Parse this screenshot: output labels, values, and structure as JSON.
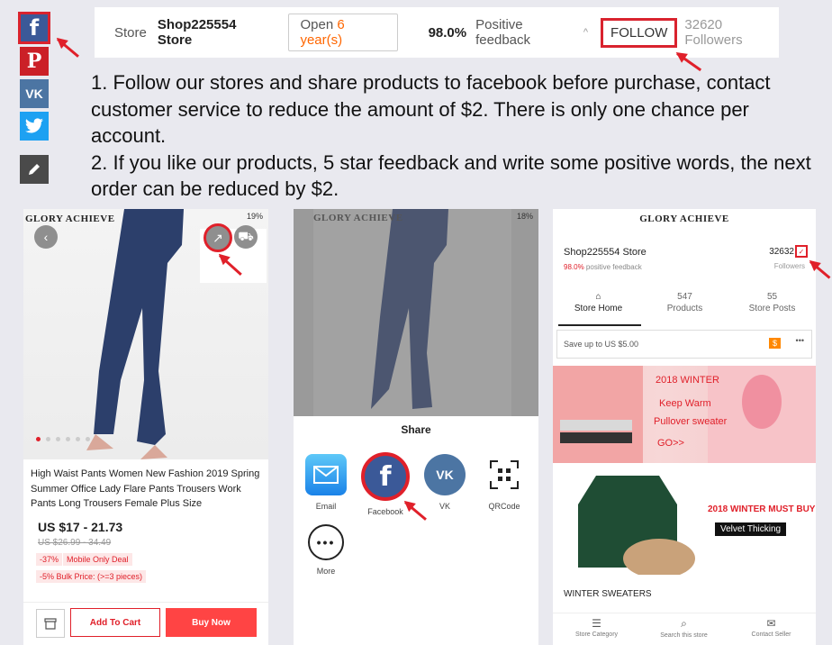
{
  "social": {
    "facebook_glyph": "f",
    "pinterest_glyph": "P",
    "vk_glyph": "VK"
  },
  "store_bar": {
    "store_label": "Store",
    "store_name": "Shop225554 Store",
    "open_prefix": "Open",
    "open_years": "6 year(s)",
    "feedback_percent": "98.0%",
    "feedback_label": "Positive feedback",
    "follow_label": "FOLLOW",
    "followers": "32620 Followers"
  },
  "instructions": {
    "line1": "1. Follow our stores and share products to facebook before purchase, contact customer service to reduce the amount of $2. There is only one chance per account.",
    "line2": "2. If you like our products, 5 star feedback and write some positive words, the next order can be reduced by $2."
  },
  "panel_product": {
    "brand": "GLORY ACHIEVE",
    "battery": "19%",
    "title": "High Waist Pants Women New Fashion 2019 Spring Summer Office Lady Flare Pants Trousers Work Pants Long Trousers Female Plus Size",
    "price": "US $17 - 21.73",
    "old_price": "US $26.99 - 34.49",
    "discount": "-37%",
    "mobile_deal": "Mobile Only Deal",
    "bulk_price": "-5% Bulk Price: (>=3 pieces)",
    "add_to_cart": "Add To Cart",
    "buy_now": "Buy Now"
  },
  "panel_share": {
    "brand": "GLORY ACHIEVE",
    "battery": "18%",
    "share_title": "Share",
    "items": {
      "email": "Email",
      "facebook": "Facebook",
      "vk": "VK",
      "qrcode": "QRCode",
      "more": "More"
    },
    "facebook_glyph": "f",
    "vk_glyph": "VK"
  },
  "panel_store": {
    "brand": "GLORY ACHIEVE",
    "store_name": "Shop225554 Store",
    "feedback_percent": "98.0%",
    "feedback_label": "positive feedback",
    "followers_count": "32632",
    "followers_label": "Followers",
    "tab_home": "Store Home",
    "tab_products_count": "547",
    "tab_products": "Products",
    "tab_posts_count": "55",
    "tab_posts": "Store Posts",
    "save_text": "Save up to US $5.00",
    "save_tag": "$",
    "banner1_line1": "2018 WINTER",
    "banner1_line2": "Keep Warm",
    "banner1_line3": "Pullover sweater",
    "banner1_line4": "GO>>",
    "banner2_title": "2018 WINTER MUST BUY",
    "banner2_sub": "Velvet Thicking",
    "section_title": "WINTER SWEATERS",
    "nav_category": "Store Category",
    "nav_search": "Search this store",
    "nav_contact": "Contact Seller"
  }
}
